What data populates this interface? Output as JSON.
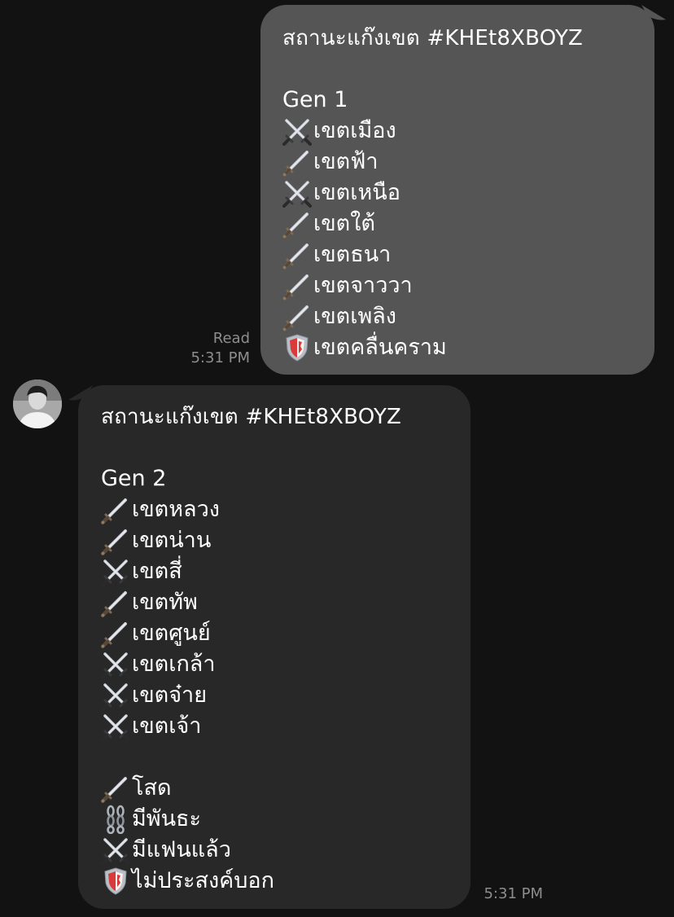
{
  "outgoing": {
    "title": "สถานะแก๊งเขต #KHEt8XBOYZ",
    "gen_label": "Gen 1",
    "items": [
      {
        "icon": "crossed-swords-icon",
        "text": "เขตเมือง"
      },
      {
        "icon": "dagger-icon",
        "text": " เขตฟ้า"
      },
      {
        "icon": "crossed-swords-icon",
        "text": "เขตเหนือ"
      },
      {
        "icon": "dagger-icon",
        "text": "เขตใต้"
      },
      {
        "icon": "dagger-icon",
        "text": "เขตธนา"
      },
      {
        "icon": "dagger-icon",
        "text": "เขตจาววา"
      },
      {
        "icon": "dagger-icon",
        "text": "เขตเพลิง"
      },
      {
        "icon": "shield-icon",
        "text": "เขตคลื่นคราม"
      }
    ],
    "read_label": "Read",
    "time": "5:31 PM"
  },
  "incoming": {
    "title": "สถานะแก๊งเขต #KHEt8XBOYZ",
    "gen_label": "Gen 2",
    "items": [
      {
        "icon": "dagger-icon",
        "text": "เขตหลวง"
      },
      {
        "icon": "dagger-icon",
        "text": "เขตน่าน"
      },
      {
        "icon": "crossed-swords-icon",
        "text": "เขตสี่"
      },
      {
        "icon": "dagger-icon",
        "text": "เขตทัพ"
      },
      {
        "icon": "dagger-icon",
        "text": "เขตศูนย์"
      },
      {
        "icon": "crossed-swords-icon",
        "text": "เขตเกล้า"
      },
      {
        "icon": "crossed-swords-icon",
        "text": "เขตจ๋าย"
      },
      {
        "icon": "crossed-swords-icon",
        "text": "เขตเจ้า"
      }
    ],
    "legend": [
      {
        "icon": "dagger-icon",
        "text": "โสด"
      },
      {
        "icon": "chains-icon",
        "text": "มีพันธะ"
      },
      {
        "icon": "crossed-swords-icon",
        "text": "มีแฟนแล้ว"
      },
      {
        "icon": "shield-icon",
        "text": "ไม่ประสงค์บอก"
      }
    ],
    "time": "5:31 PM"
  },
  "colors": {
    "background": "#121212",
    "outgoing_bubble": "#555555",
    "incoming_bubble": "#282828",
    "meta_text": "#8d8d8d"
  }
}
